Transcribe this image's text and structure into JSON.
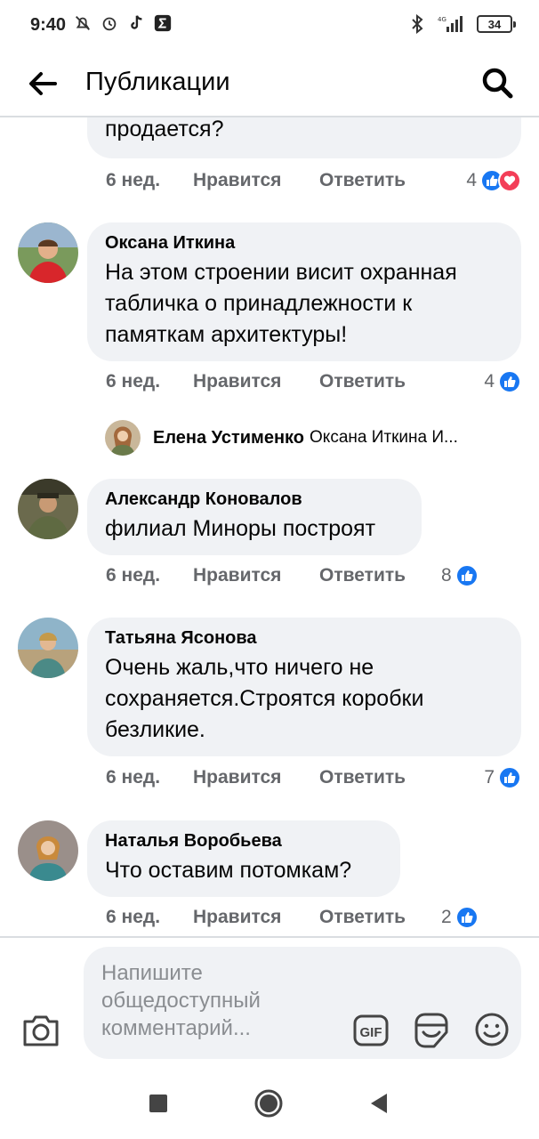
{
  "status_bar": {
    "time": "9:40",
    "battery": "34",
    "network": "4G"
  },
  "header": {
    "title": "Публикации"
  },
  "top_comment": {
    "text_tail": "продается?",
    "time": "6 нед.",
    "like_label": "Нравится",
    "reply_label": "Ответить",
    "reaction_count": "4",
    "reactions": [
      "like-icon",
      "love-icon"
    ]
  },
  "comments": [
    {
      "author": "Оксана Иткина",
      "text": "На этом строении висит охранная табличка о принадлежности к памяткам архитектуры!",
      "time": "6 нед.",
      "like_label": "Нравится",
      "reply_label": "Ответить",
      "reaction_count": "4"
    },
    {
      "author": "Александр Коновалов",
      "text": "филиал Миноры построят",
      "time": "6 нед.",
      "like_label": "Нравится",
      "reply_label": "Ответить",
      "reaction_count": "8"
    },
    {
      "author": "Татьяна Ясонова",
      "text": "Очень жаль,что ничего не сохраняется.Строятся коробки безликие.",
      "time": "6 нед.",
      "like_label": "Нравится",
      "reply_label": "Ответить",
      "reaction_count": "7"
    },
    {
      "author": "Наталья Воробьева",
      "text": "Что оставим потомкам?",
      "time": "6 нед.",
      "like_label": "Нравится",
      "reply_label": "Ответить",
      "reaction_count": "2"
    }
  ],
  "reply_preview": {
    "author": "Елена Устименко",
    "snippet": "Оксана Иткина И..."
  },
  "composer": {
    "placeholder": "Напишите общедоступный комментарий...",
    "gif_label": "GIF"
  },
  "colors": {
    "bubble": "#f0f2f5",
    "meta_text": "#65676b",
    "like_blue": "#1877f2",
    "love_red": "#f33e58"
  }
}
